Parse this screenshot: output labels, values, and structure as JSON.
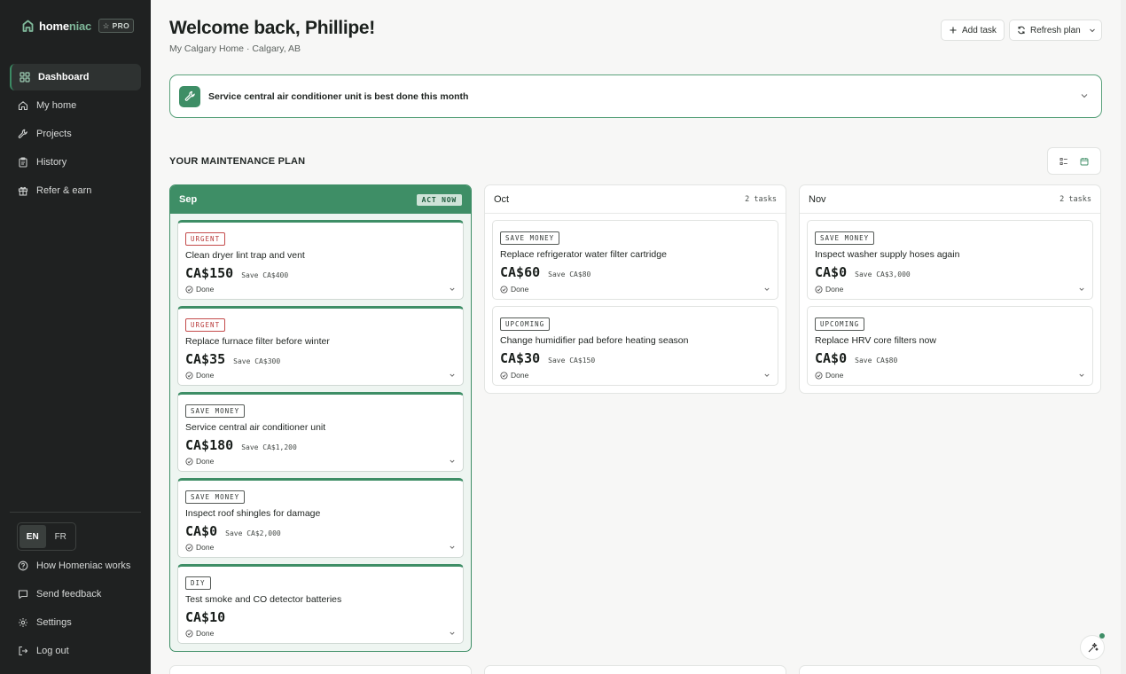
{
  "brand": {
    "name_start": "home",
    "name_end": "niac",
    "badge": "☆ PRO",
    "accent": "#3e8e66"
  },
  "sidebar": {
    "items": [
      {
        "label": "Dashboard",
        "icon": "grid-icon",
        "active": true
      },
      {
        "label": "My home",
        "icon": "house-icon"
      },
      {
        "label": "Projects",
        "icon": "wrench-icon"
      },
      {
        "label": "History",
        "icon": "clipboard-icon"
      },
      {
        "label": "Refer & earn",
        "icon": "gift-icon"
      }
    ],
    "languages": [
      "EN",
      "FR"
    ],
    "active_language": "EN",
    "footer": [
      {
        "label": "How Homeniac works",
        "icon": "help-circle-icon"
      },
      {
        "label": "Send feedback",
        "icon": "message-icon"
      },
      {
        "label": "Settings",
        "icon": "gear-icon"
      },
      {
        "label": "Log out",
        "icon": "logout-icon"
      }
    ]
  },
  "header": {
    "title": "Welcome back, Phillipe!",
    "subtitle": "My Calgary Home · Calgary, AB",
    "add_task": "Add task",
    "refresh_plan": "Refresh plan"
  },
  "banner": {
    "text": "Service central air conditioner unit is best done this month"
  },
  "plan": {
    "title": "YOUR MAINTENANCE PLAN",
    "columns": [
      {
        "month": "Sep",
        "badge": "ACT NOW",
        "cards": [
          {
            "tag": "URGENT",
            "title": "Clean dryer lint trap and vent",
            "price": "CA$150",
            "save": "Save CA$400",
            "status": "Done"
          },
          {
            "tag": "URGENT",
            "title": "Replace furnace filter before winter",
            "price": "CA$35",
            "save": "Save CA$300",
            "status": "Done"
          },
          {
            "tag": "SAVE MONEY",
            "title": "Service central air conditioner unit",
            "price": "CA$180",
            "save": "Save CA$1,200",
            "status": "Done"
          },
          {
            "tag": "SAVE MONEY",
            "title": "Inspect roof shingles for damage",
            "price": "CA$0",
            "save": "Save CA$2,000",
            "status": "Done"
          },
          {
            "tag": "DIY",
            "title": "Test smoke and CO detector batteries",
            "price": "CA$10",
            "save": "",
            "status": "Done"
          }
        ]
      },
      {
        "month": "Oct",
        "count": "2 tasks",
        "cards": [
          {
            "tag": "SAVE MONEY",
            "title": "Replace refrigerator water filter cartridge",
            "price": "CA$60",
            "save": "Save CA$80",
            "status": "Done"
          },
          {
            "tag": "UPCOMING",
            "title": "Change humidifier pad before heating season",
            "price": "CA$30",
            "save": "Save CA$150",
            "status": "Done"
          }
        ]
      },
      {
        "month": "Nov",
        "count": "2 tasks",
        "cards": [
          {
            "tag": "SAVE MONEY",
            "title": "Inspect washer supply hoses again",
            "price": "CA$0",
            "save": "Save CA$3,000",
            "status": "Done"
          },
          {
            "tag": "UPCOMING",
            "title": "Replace HRV core filters now",
            "price": "CA$0",
            "save": "Save CA$80",
            "status": "Done"
          }
        ]
      }
    ]
  }
}
